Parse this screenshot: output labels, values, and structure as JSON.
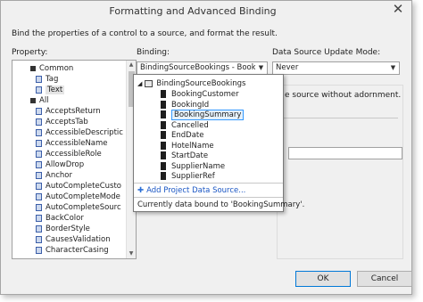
{
  "dialog": {
    "title": "Formatting and Advanced Binding",
    "close_glyph": "✕",
    "description": "Bind the properties of a control to a source, and format the result."
  },
  "property_panel": {
    "label": "Property:",
    "items": [
      {
        "text": "Common",
        "kind": "category",
        "indent": 0
      },
      {
        "text": "Tag",
        "kind": "property",
        "indent": 1
      },
      {
        "text": "Text",
        "kind": "property",
        "indent": 1,
        "selected": true
      },
      {
        "text": "All",
        "kind": "category",
        "indent": 0
      },
      {
        "text": "AcceptsReturn",
        "kind": "property",
        "indent": 1
      },
      {
        "text": "AcceptsTab",
        "kind": "property",
        "indent": 1
      },
      {
        "text": "AccessibleDescriptic",
        "kind": "property",
        "indent": 1
      },
      {
        "text": "AccessibleName",
        "kind": "property",
        "indent": 1
      },
      {
        "text": "AccessibleRole",
        "kind": "property",
        "indent": 1
      },
      {
        "text": "AllowDrop",
        "kind": "property",
        "indent": 1
      },
      {
        "text": "Anchor",
        "kind": "property",
        "indent": 1
      },
      {
        "text": "AutoCompleteCusto",
        "kind": "property",
        "indent": 1
      },
      {
        "text": "AutoCompleteMode",
        "kind": "property",
        "indent": 1
      },
      {
        "text": "AutoCompleteSourc",
        "kind": "property",
        "indent": 1
      },
      {
        "text": "BackColor",
        "kind": "property",
        "indent": 1
      },
      {
        "text": "BorderStyle",
        "kind": "property",
        "indent": 1
      },
      {
        "text": "CausesValidation",
        "kind": "property",
        "indent": 1
      },
      {
        "text": "CharacterCasing",
        "kind": "property",
        "indent": 1
      }
    ]
  },
  "binding": {
    "label": "Binding:",
    "value": "BindingSourceBookings - BookingSu",
    "dropdown": {
      "root": "BindingSourceBookings",
      "fields": [
        "BookingCustomer",
        "BookingId",
        "BookingSummary",
        "Cancelled",
        "EndDate",
        "HotelName",
        "StartDate",
        "SupplierName",
        "SupplierRef"
      ],
      "selected_field": "BookingSummary",
      "add_link": "Add Project Data Source...",
      "status": "Currently data bound to 'BookingSummary'."
    }
  },
  "update_mode": {
    "label": "Data Source Update Mode:",
    "value": "Never"
  },
  "right_pane": {
    "partial_text": "e source without adornment."
  },
  "buttons": {
    "ok": "OK",
    "cancel": "Cancel"
  },
  "arrows": {
    "dropdown": "▼",
    "up": "▲",
    "down": "▼",
    "collapse": "◢"
  }
}
